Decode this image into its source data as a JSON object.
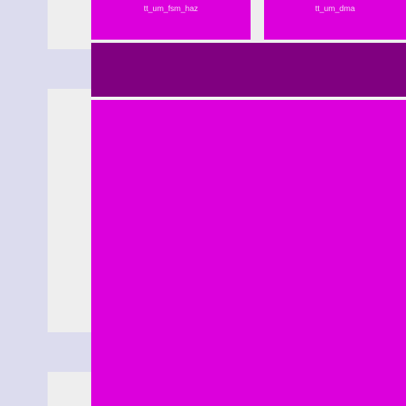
{
  "tiles": [
    {
      "label": "tt_um_fsm_haz"
    },
    {
      "label": "tt_um_dma"
    }
  ],
  "colors": {
    "background": "#dcdcee",
    "gutter": "#eeeeee",
    "tile": "#dc00dc",
    "header": "#800080"
  }
}
